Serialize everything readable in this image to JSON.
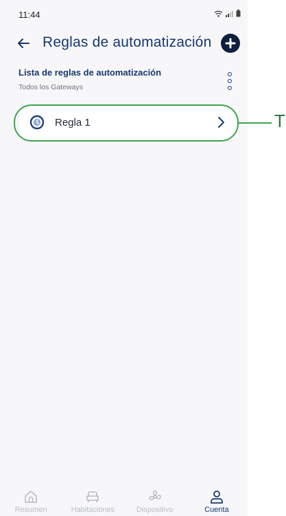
{
  "status_bar": {
    "time": "11:44",
    "icons": [
      "wifi-icon",
      "signal-icon",
      "battery-icon"
    ]
  },
  "header": {
    "back_icon": "arrow-left-icon",
    "title": "Reglas de automatización",
    "add_icon": "plus-circle-icon"
  },
  "section": {
    "title": "Lista de reglas de automatización",
    "subtitle": "Todos los Gateways",
    "menu_icon": "more-vertical-icon"
  },
  "rules": [
    {
      "label": "Regla 1",
      "icon": "clock-icon",
      "chevron": "chevron-right-icon"
    }
  ],
  "annotation": {
    "text": "T",
    "color": "#3aa547"
  },
  "bottom_nav": {
    "items": [
      {
        "label": "Resumen",
        "icon": "home-icon",
        "active": false
      },
      {
        "label": "Habitaciones",
        "icon": "sofa-icon",
        "active": false
      },
      {
        "label": "Dispositivo",
        "icon": "fan-icon",
        "active": false
      },
      {
        "label": "Cuenta",
        "icon": "user-icon",
        "active": true
      }
    ]
  },
  "colors": {
    "primary": "#17386f",
    "highlight": "#3aa547",
    "inactive": "#b7bcc5",
    "background": "#f7f7f9"
  }
}
